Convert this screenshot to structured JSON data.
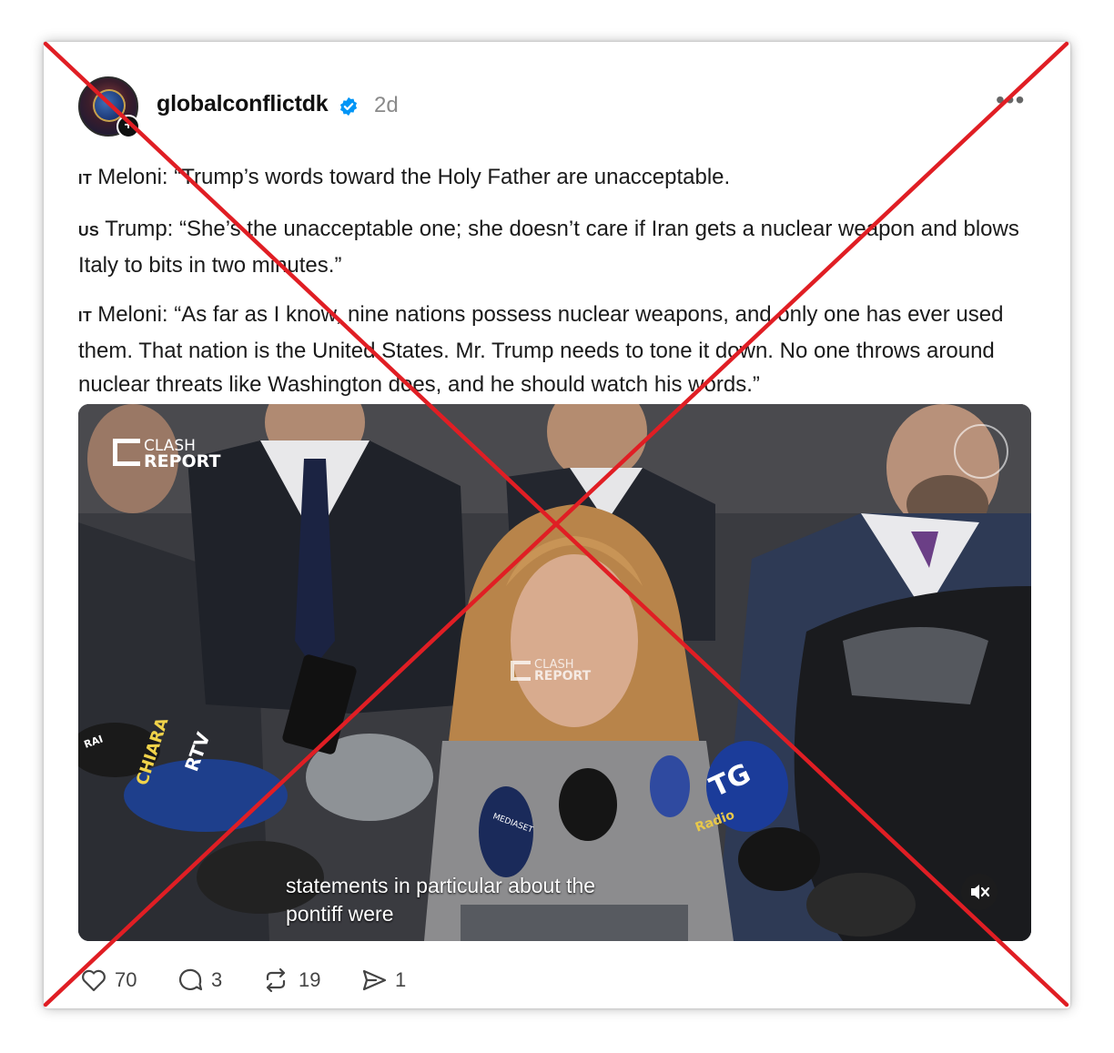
{
  "post": {
    "username": "globalconflictdk",
    "time": "2d",
    "more_label": "•••",
    "paragraphs": [
      {
        "flag": "IT",
        "text": "Meloni: “Trump’s words toward the Holy Father are unacceptable."
      },
      {
        "flag": "US",
        "text": "Trump: “She’s the unacceptable one; she doesn’t care if Iran gets a nuclear weapon and blows Italy to bits in two minutes.”"
      },
      {
        "flag": "IT",
        "text": "Meloni: “As far as I know, nine nations possess nuclear weapons, and only one has ever used them. That nation is the United States. Mr. Trump needs to tone it down. No one throws around nuclear threats like Washington does, and he should watch his words.”"
      }
    ]
  },
  "video": {
    "logo_line1": "CLASH",
    "logo_line2": "REPORT",
    "subtitle_line1": "statements in particular about the",
    "subtitle_line2": "pontiff were",
    "mic_labels": [
      "CHIARA",
      "RTV",
      "TG",
      "Radio",
      "MEDIASET",
      "RAI"
    ]
  },
  "actions": {
    "likes": "70",
    "comments": "3",
    "reposts": "19",
    "shares": "1"
  },
  "colors": {
    "overlay_x": "#e01e24",
    "verified_badge": "#0095f6",
    "meta_gray": "#8a8a8a"
  }
}
